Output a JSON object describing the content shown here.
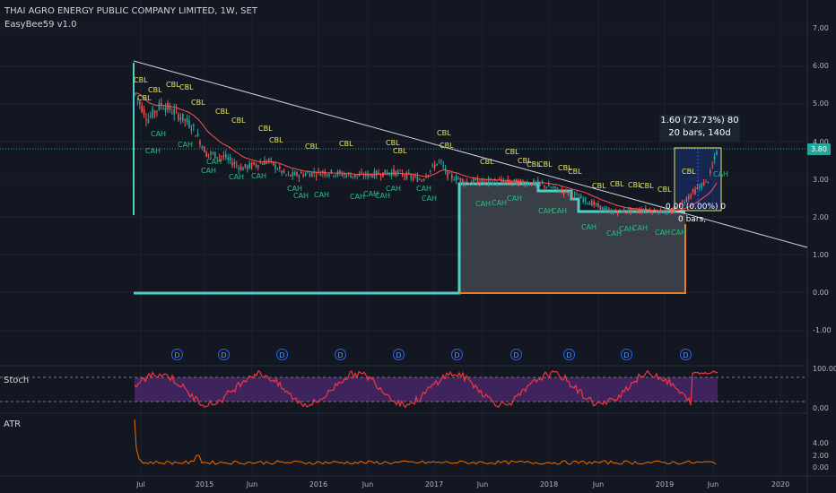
{
  "header": {
    "symbol_title": "THAI AGRO ENERGY PUBLIC COMPANY LIMITED, 1W, SET",
    "indicator_name": "EasyBee59 v1.0"
  },
  "price_axis": {
    "ticks": [
      "7.00",
      "6.00",
      "5.00",
      "4.00",
      "3.00",
      "2.00",
      "1.00",
      "0.00",
      "-1.00"
    ],
    "current_price_label": "3.80",
    "current_price": 3.8,
    "range": [
      -1.3,
      7.5
    ]
  },
  "time_axis": {
    "ticks": [
      "Jul",
      "2015",
      "Jun",
      "2016",
      "Jun",
      "2017",
      "Jun",
      "2018",
      "Jun",
      "2019",
      "Jun",
      "2020"
    ]
  },
  "measure_tool": {
    "line1": "1.60 (72.73%) 80",
    "line2": "20 bars, 140d",
    "zero_line": "0.00 (0.00%) 0",
    "zero_bars": "0 bars,"
  },
  "signal_labels": {
    "buy": "CBL",
    "sell": "CAH"
  },
  "dividend_marker": "D",
  "stoch_pane": {
    "label": "Stoch",
    "ticks": [
      "100.00",
      "0.00"
    ],
    "upper": 80,
    "lower": 20
  },
  "atr_pane": {
    "label": "ATR",
    "ticks": [
      "4.00",
      "2.00",
      "0.00"
    ]
  },
  "colors": {
    "background": "#131722",
    "candle_up": "#26a69a",
    "candle_down": "#ef5350",
    "ema": "#ff5252",
    "box_line": "#4dd0c8",
    "box_fill": "#5b5e66",
    "orange_line": "#e67e22",
    "stoch_band": "#5e2c86",
    "stoch_line": "#f23645",
    "atr_line": "#ef6c00",
    "trend_line": "#d1d4dc",
    "cbl_text": "#e6e663",
    "cah_text": "#26c281",
    "dividend": "#2962ff"
  }
}
